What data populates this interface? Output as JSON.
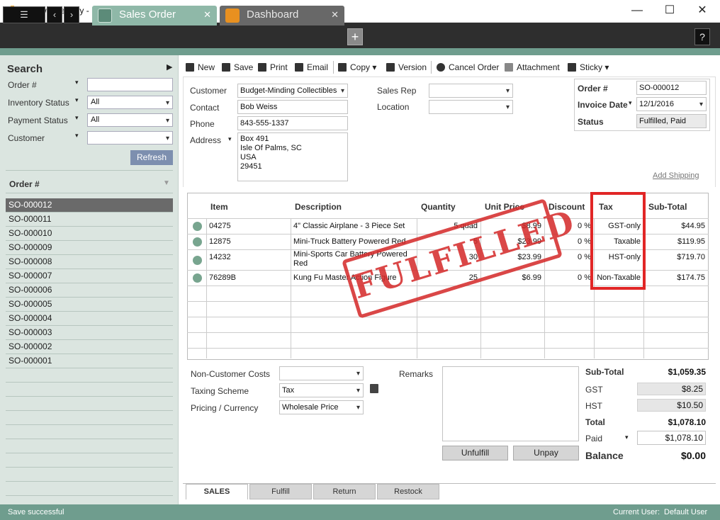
{
  "window": {
    "title": "inFlow Inventory - Premium Edition",
    "minimize": "—",
    "maximize": "☐",
    "close": "✕"
  },
  "nav": {
    "menu": "☰",
    "back": "‹",
    "forward": "›"
  },
  "tabs": [
    {
      "label": "Sales Order",
      "close": "✕"
    },
    {
      "label": "Dashboard",
      "close": "✕"
    }
  ],
  "plus": "+",
  "help": "?",
  "search": {
    "title": "Search",
    "order_label": "Order #",
    "inventory_status_label": "Inventory Status",
    "inventory_status_value": "All",
    "payment_status_label": "Payment Status",
    "payment_status_value": "All",
    "customer_label": "Customer",
    "refresh": "Refresh"
  },
  "orders": {
    "header": "Order #",
    "items": [
      "SO-000012",
      "SO-000011",
      "SO-000010",
      "SO-000009",
      "SO-000008",
      "SO-000007",
      "SO-000006",
      "SO-000005",
      "SO-000004",
      "SO-000003",
      "SO-000002",
      "SO-000001"
    ],
    "selected": 0
  },
  "toolbar": {
    "new": "New",
    "save": "Save",
    "print": "Print",
    "email": "Email",
    "copy": "Copy",
    "version": "Version",
    "cancel": "Cancel Order",
    "attachment": "Attachment",
    "sticky": "Sticky"
  },
  "form": {
    "customer_label": "Customer",
    "customer": "Budget-Minding Collectibles",
    "contact_label": "Contact",
    "contact": "Bob Weiss",
    "phone_label": "Phone",
    "phone": "843-555-1337",
    "address_label": "Address",
    "address": [
      "Box 491",
      "Isle Of Palms, SC",
      "USA",
      "29451"
    ],
    "sales_rep_label": "Sales Rep",
    "location_label": "Location",
    "order_no_label": "Order #",
    "order_no": "SO-000012",
    "invoice_date_label": "Invoice Date",
    "invoice_date": "12/1/2016",
    "status_label": "Status",
    "status": "Fulfilled, Paid",
    "add_shipping": "Add Shipping"
  },
  "grid": {
    "columns": [
      "Item",
      "Description",
      "Quantity",
      "Unit Price",
      "Discount",
      "Tax",
      "Sub-Total"
    ],
    "rows": [
      {
        "item": "04275",
        "description": "4\" Classic Airplane - 3 Piece Set",
        "quantity": "5 quad",
        "unit_price": "$8.99",
        "discount": "0 %",
        "tax": "GST-only",
        "subtotal": "$44.95"
      },
      {
        "item": "12875",
        "description": "Mini-Truck Battery Powered Red",
        "quantity": "5",
        "unit_price": "$23.99",
        "discount": "0 %",
        "tax": "Taxable",
        "subtotal": "$119.95"
      },
      {
        "item": "14232",
        "description": "Mini-Sports Car Battery Powered Red",
        "quantity": "30",
        "unit_price": "$23.99",
        "discount": "0 %",
        "tax": "HST-only",
        "subtotal": "$719.70"
      },
      {
        "item": "76289B",
        "description": "Kung Fu Master Action Figure",
        "quantity": "25",
        "unit_price": "$6.99",
        "discount": "0 %",
        "tax": "Non-Taxable",
        "subtotal": "$174.75"
      }
    ],
    "stamp": "FULFILLED"
  },
  "bottom": {
    "non_customer_costs_label": "Non-Customer Costs",
    "taxing_scheme_label": "Taxing Scheme",
    "taxing_scheme": "Tax",
    "pricing_label": "Pricing / Currency",
    "pricing": "Wholesale Price",
    "remarks_label": "Remarks",
    "unfulfill": "Unfulfill",
    "unpay": "Unpay"
  },
  "totals": {
    "subtotal_label": "Sub-Total",
    "subtotal": "$1,059.35",
    "gst_label": "GST",
    "gst": "$8.25",
    "hst_label": "HST",
    "hst": "$10.50",
    "total_label": "Total",
    "total": "$1,078.10",
    "paid_label": "Paid",
    "paid": "$1,078.10",
    "balance_label": "Balance",
    "balance": "$0.00"
  },
  "bottom_tabs": [
    "SALES",
    "Fulfill",
    "Return",
    "Restock"
  ],
  "statusbar": {
    "message": "Save successful",
    "user_label": "Current User:",
    "user": "Default User"
  },
  "colors": {
    "accent": "#6f9d8e",
    "tab_active": "#8fb8a8",
    "highlight": "#e12626"
  }
}
